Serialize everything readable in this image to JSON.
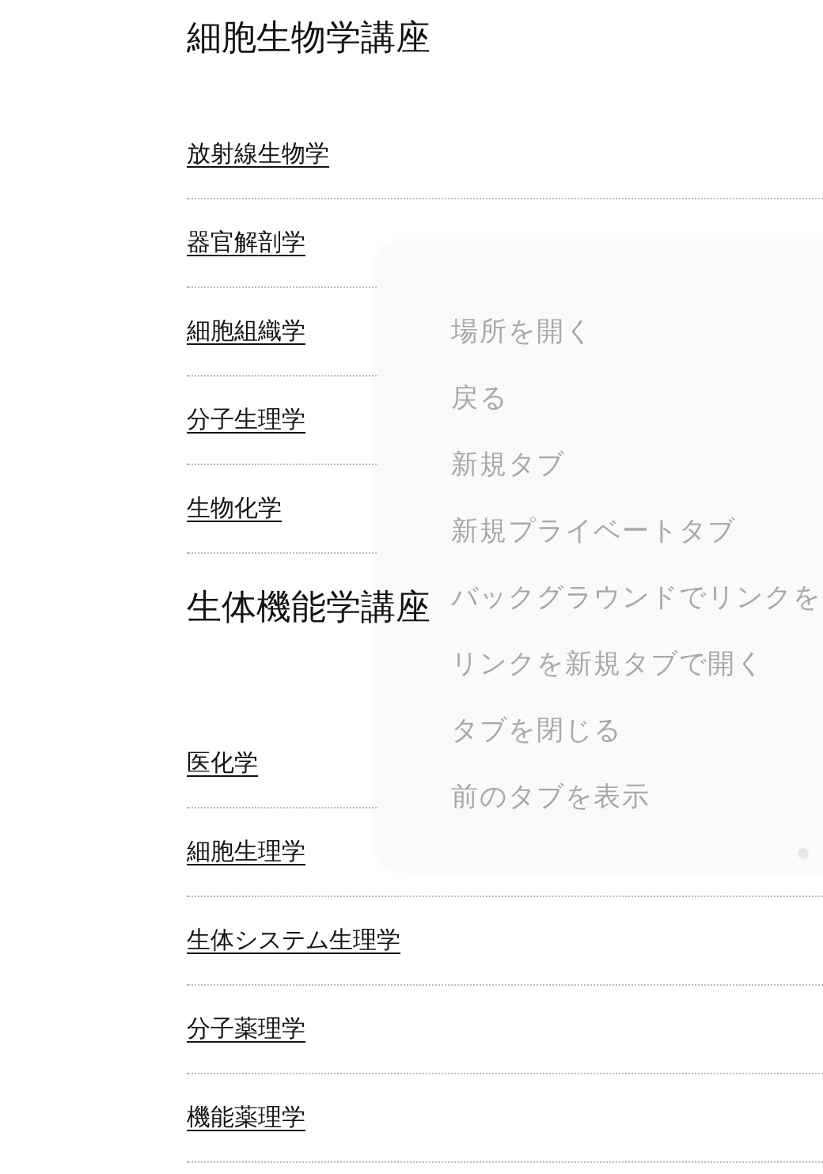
{
  "sections": [
    {
      "heading": "細胞生物学講座",
      "links": [
        "放射線生物学",
        "器官解剖学",
        "細胞組織学",
        "分子生理学",
        "生物化学"
      ]
    },
    {
      "heading": "生体機能学講座",
      "links": [
        "医化学",
        "細胞生理学",
        "生体システム生理学",
        "分子薬理学",
        "機能薬理学"
      ]
    }
  ],
  "shortcut_menu": {
    "items": [
      "場所を開く",
      "戻る",
      "新規タブ",
      "新規プライベートタブ",
      "バックグラウンドでリンクを",
      "リンクを新規タブで開く",
      "タブを閉じる",
      "前のタブを表示"
    ]
  }
}
